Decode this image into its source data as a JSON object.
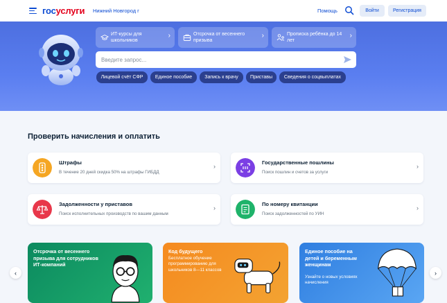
{
  "header": {
    "logo_part1": "гос",
    "logo_part2": "услуги",
    "city": "Нижний Новгород г",
    "help": "Помощь",
    "login": "Войти",
    "register": "Регистрация"
  },
  "hero": {
    "quick_links": [
      {
        "label": "ИТ-курсы для школьников",
        "icon": "graduation-cap-icon"
      },
      {
        "label": "Отсрочка от весеннего призыва",
        "icon": "briefcase-icon"
      },
      {
        "label": "Прописка ребёнка до 14 лет",
        "icon": "family-icon"
      }
    ],
    "search_placeholder": "Введите запрос...",
    "chips": [
      "Лицевой счёт СФР",
      "Единое пособие",
      "Запись к врачу",
      "Приставы",
      "Сведения о соцвыплатах"
    ]
  },
  "section": {
    "title": "Проверить начисления и оплатить",
    "cards": [
      {
        "title": "Штрафы",
        "subtitle": "В течение 20 дней скидка 50% на штрафы ГИБДД",
        "color": "#f5a623",
        "icon": "traffic-light-icon"
      },
      {
        "title": "Государственные пошлины",
        "subtitle": "Поиск пошлин и счетов за услуги",
        "color": "#7b3fe4",
        "icon": "receipt-icon"
      },
      {
        "title": "Задолженности у приставов",
        "subtitle": "Поиск исполнительных производств по вашим данным",
        "color": "#e8374a",
        "icon": "scales-icon"
      },
      {
        "title": "По номеру квитанции",
        "subtitle": "Поиск задолженностей по УИН",
        "color": "#1fb36a",
        "icon": "document-icon"
      }
    ]
  },
  "promos": [
    {
      "title": "Отсрочка от весеннего призыва для сотрудников ИТ-компаний",
      "subtitle": ""
    },
    {
      "title": "Код будущего",
      "subtitle": "Бесплатное обучение программированию для школьников 8—11 классов"
    },
    {
      "title": "Единое пособие на детей и беременным женщинам",
      "subtitle": "Узнайте о новых условиях начисления"
    }
  ],
  "colors": {
    "brand_blue": "#0d4cd3",
    "brand_red": "#e3001b",
    "hero_blue": "#5a7ef0"
  }
}
